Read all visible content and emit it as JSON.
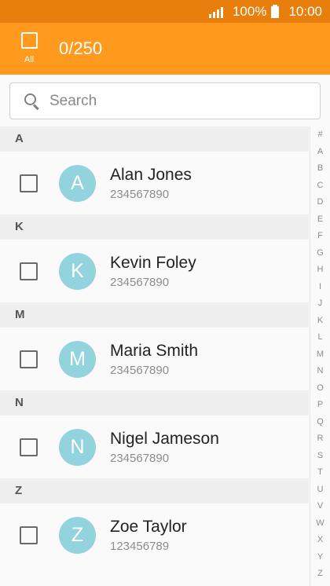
{
  "status_bar": {
    "battery": "100%",
    "time": "10:00"
  },
  "action_bar": {
    "select_all_label": "All",
    "counter": "0/250"
  },
  "search": {
    "placeholder": "Search"
  },
  "sections": [
    {
      "letter": "A",
      "contact": {
        "initial": "A",
        "name": "Alan Jones",
        "number": "234567890"
      }
    },
    {
      "letter": "K",
      "contact": {
        "initial": "K",
        "name": "Kevin Foley",
        "number": "234567890"
      }
    },
    {
      "letter": "M",
      "contact": {
        "initial": "M",
        "name": "Maria Smith",
        "number": "234567890"
      }
    },
    {
      "letter": "N",
      "contact": {
        "initial": "N",
        "name": "Nigel Jameson",
        "number": "234567890"
      }
    },
    {
      "letter": "Z",
      "contact": {
        "initial": "Z",
        "name": "Zoe Taylor",
        "number": "123456789"
      }
    }
  ],
  "index_letters": [
    "#",
    "A",
    "B",
    "C",
    "D",
    "E",
    "F",
    "G",
    "H",
    "I",
    "J",
    "K",
    "L",
    "M",
    "N",
    "O",
    "P",
    "Q",
    "R",
    "S",
    "T",
    "U",
    "V",
    "W",
    "X",
    "Y",
    "Z"
  ],
  "colors": {
    "status_bar": "#e87e0b",
    "action_bar": "#ff9a1f",
    "avatar": "#92d3de"
  },
  "icons": {
    "signal": "signal-icon",
    "battery": "battery-icon",
    "search": "search-icon"
  }
}
